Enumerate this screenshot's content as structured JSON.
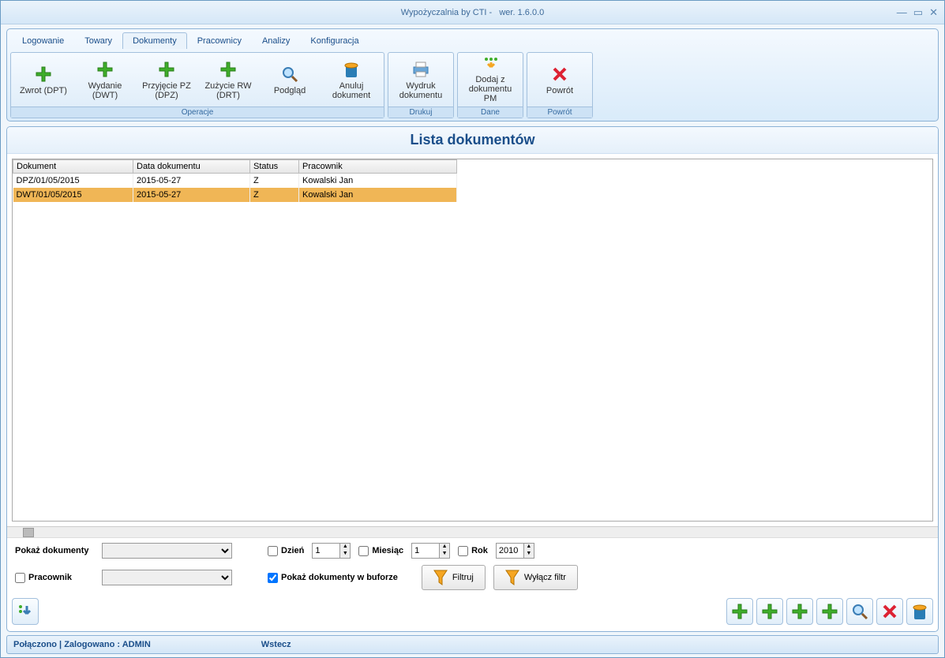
{
  "title_prefix": "Wypożyczalnia by CTI -",
  "title_version": "wer. 1.6.0.0",
  "tabs": [
    "Logowanie",
    "Towary",
    "Dokumenty",
    "Pracownicy",
    "Analizy",
    "Konfiguracja"
  ],
  "active_tab": 2,
  "groups": {
    "operacje": {
      "label": "Operacje",
      "buttons": [
        {
          "name": "zwrot-dpt",
          "label": "Zwrot (DPT)",
          "icon": "plus-green"
        },
        {
          "name": "wydanie-dwt",
          "label": "Wydanie (DWT)",
          "icon": "plus-green"
        },
        {
          "name": "przyjecie-pz",
          "label": "Przyjęcie PZ (DPZ)",
          "icon": "plus-green"
        },
        {
          "name": "zuzycie-rw",
          "label": "Zużycie RW (DRT)",
          "icon": "plus-green"
        },
        {
          "name": "podglad",
          "label": "Podgląd",
          "icon": "magnifier"
        },
        {
          "name": "anuluj-dokument",
          "label": "Anuluj dokument",
          "icon": "trash-blue"
        }
      ]
    },
    "drukuj": {
      "label": "Drukuj",
      "buttons": [
        {
          "name": "wydruk-dokumentu",
          "label": "Wydruk dokumentu",
          "icon": "printer"
        }
      ]
    },
    "dane": {
      "label": "Dane",
      "buttons": [
        {
          "name": "dodaj-z-pm",
          "label": "Dodaj z dokumentu PM",
          "icon": "down-green"
        }
      ]
    },
    "powrot": {
      "label": "Powrót",
      "buttons": [
        {
          "name": "powrot",
          "label": "Powrót",
          "icon": "x-red"
        }
      ]
    }
  },
  "page_title": "Lista dokumentów",
  "grid": {
    "columns": [
      "Dokument",
      "Data dokumentu",
      "Status",
      "Pracownik"
    ],
    "rows": [
      {
        "cells": [
          "DPZ/01/05/2015",
          "2015-05-27",
          "Z",
          "Kowalski Jan"
        ],
        "selected": false
      },
      {
        "cells": [
          "DWT/01/05/2015",
          "2015-05-27",
          "Z",
          "Kowalski Jan"
        ],
        "selected": true
      }
    ]
  },
  "filters": {
    "pokaz_dokumenty_label": "Pokaż dokumenty",
    "pracownik_label": "Pracownik",
    "dzien_label": "Dzień",
    "dzien_value": "1",
    "miesiac_label": "Miesiąc",
    "miesiac_value": "1",
    "rok_label": "Rok",
    "rok_value": "2010",
    "bufor_label": "Pokaż dokumenty w buforze",
    "bufor_checked": true,
    "filtruj_label": "Filtruj",
    "wylacz_filtr_label": "Wyłącz filtr"
  },
  "bottom_toolbar": {
    "left": {
      "name": "refresh-down",
      "icon": "down-arrow-blue"
    },
    "right": [
      {
        "name": "add-1",
        "icon": "plus-green"
      },
      {
        "name": "add-2",
        "icon": "plus-green"
      },
      {
        "name": "add-3",
        "icon": "plus-green"
      },
      {
        "name": "add-4",
        "icon": "plus-green"
      },
      {
        "name": "view",
        "icon": "magnifier"
      },
      {
        "name": "delete",
        "icon": "x-red"
      },
      {
        "name": "bin",
        "icon": "trash-blue"
      }
    ]
  },
  "status": {
    "left": "Połączono | Zalogowano : ADMIN",
    "right": "Wstecz"
  }
}
